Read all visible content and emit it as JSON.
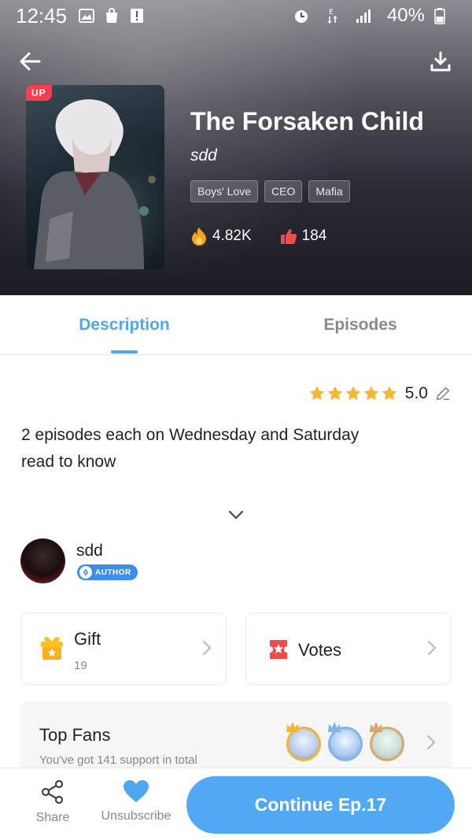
{
  "status_bar": {
    "time": "12:45",
    "battery": "40%"
  },
  "comic": {
    "cover_badge": "UP",
    "title": "The Forsaken Child",
    "author": "sdd",
    "tags": [
      "Boys' Love",
      "CEO",
      "Mafia"
    ],
    "views": "4.82K",
    "likes": "184"
  },
  "tabs": {
    "description": "Description",
    "episodes": "Episodes",
    "active": "description"
  },
  "rating": {
    "value": "5.0",
    "stars": 5
  },
  "description": {
    "line1": "2 episodes each on Wednesday and Saturday",
    "line2": "read to know"
  },
  "author_section": {
    "name": "sdd",
    "badge": "AUTHOR"
  },
  "gift_card": {
    "label": "Gift",
    "count": "19"
  },
  "votes_card": {
    "label": "Votes"
  },
  "top_fans": {
    "title": "Top Fans",
    "subtitle": "You've got 141 support in total"
  },
  "bottom_bar": {
    "share_label": "Share",
    "unsubscribe_label": "Unsubscribe",
    "continue_label": "Continue Ep.17"
  },
  "colors": {
    "accent": "#4fa8ef",
    "continue_button": "#52a9f3",
    "up_badge": "#ff3b4e",
    "star": "#f7b731",
    "like": "#f04a4a",
    "fire": "#f7a21b"
  }
}
